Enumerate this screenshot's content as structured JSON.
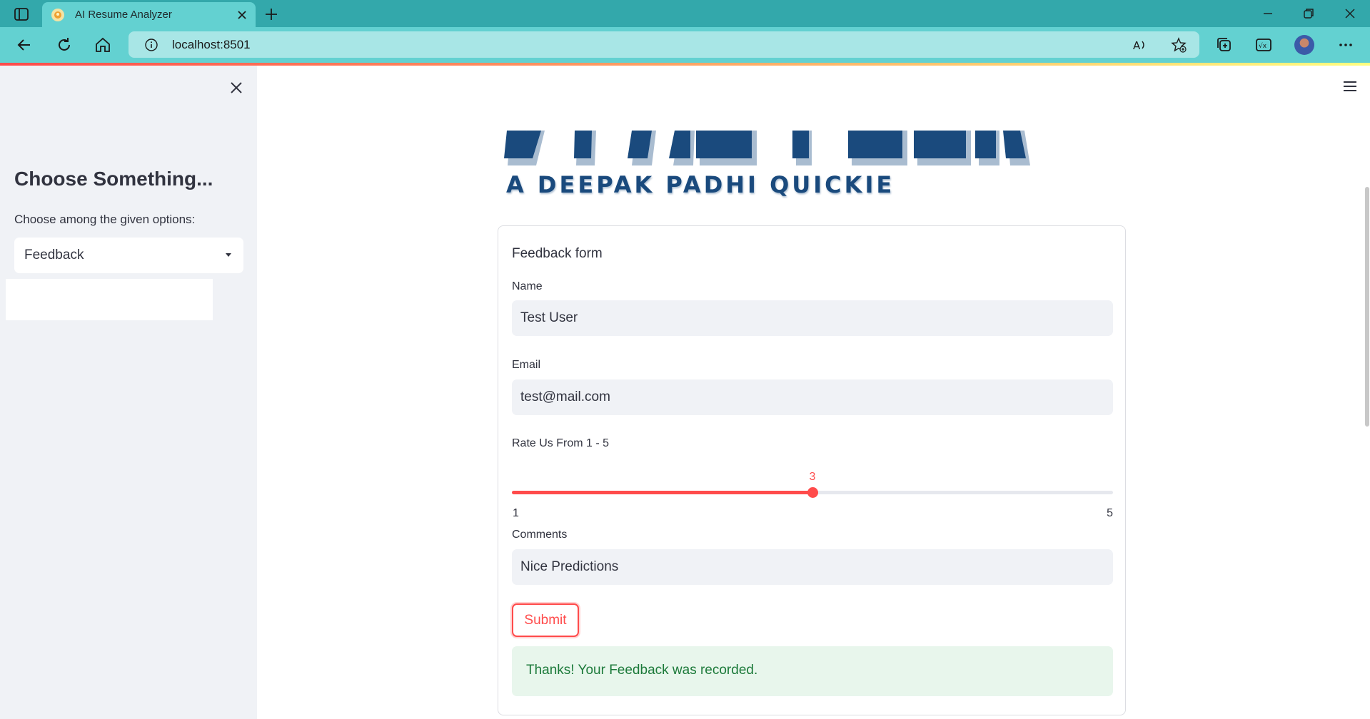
{
  "browser": {
    "tab_title": "AI Resume Analyzer",
    "url": "localhost:8501"
  },
  "colors": {
    "browser_frame": "#33a8ab",
    "browser_toolbar": "#63d1d1",
    "accent": "#ff4b4b",
    "success_bg": "#e8f6ec",
    "success_text": "#1c7a3a",
    "heading_blue": "#1a4a7d"
  },
  "sidebar": {
    "heading": "Choose Something...",
    "select_label": "Choose among the given options:",
    "select_value": "Feedback"
  },
  "main": {
    "banner_icon": "cropped-logo-banner",
    "subtitle": "A DEEPAK PADHI QUICKIE"
  },
  "form": {
    "title": "Feedback form",
    "name_label": "Name",
    "name_value": "Test User",
    "email_label": "Email",
    "email_value": "test@mail.com",
    "rating_label": "Rate Us From 1 - 5",
    "rating_value": 3,
    "rating_value_text": "3",
    "rating_min": 1,
    "rating_max": 5,
    "rating_min_text": "1",
    "rating_max_text": "5",
    "comments_label": "Comments",
    "comments_value": "Nice Predictions",
    "submit_label": "Submit",
    "success_message": "Thanks! Your Feedback was recorded."
  }
}
